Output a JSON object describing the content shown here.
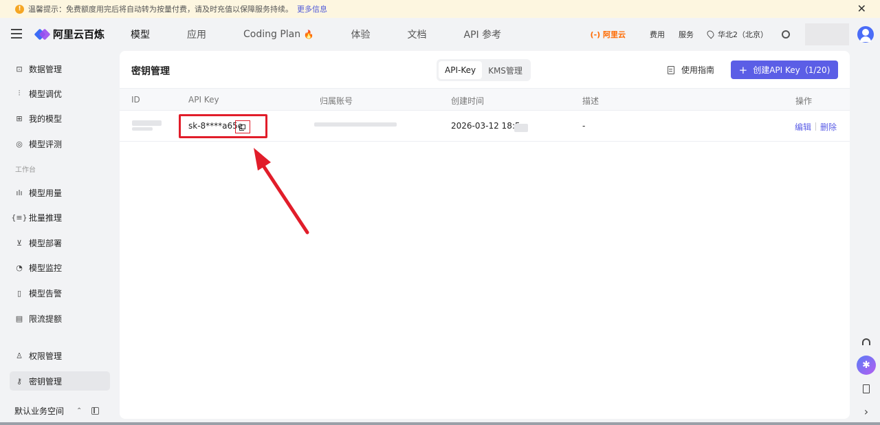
{
  "notice": {
    "text": "温馨提示：免费额度用完后将自动转为按量付费，请及时充值以保障服务持续。",
    "more_link": "更多信息",
    "warn_glyph": "!",
    "close_glyph": "✕"
  },
  "brand": {
    "name": "阿里云百炼"
  },
  "nav": {
    "tabs": [
      {
        "label": "模型"
      },
      {
        "label": "应用"
      },
      {
        "label": "Coding Plan"
      },
      {
        "label": "体验"
      },
      {
        "label": "文档"
      },
      {
        "label": "API 参考"
      }
    ],
    "flame": "🔥",
    "aliyun": "(-) 阿里云",
    "fee": "费用",
    "service": "服务",
    "region": "华北2（北京）"
  },
  "sidebar": {
    "items": [
      {
        "label": "数据管理",
        "icon": "chart-line-icon",
        "glyph": "⊡"
      },
      {
        "label": "模型调优",
        "icon": "sliders-icon",
        "glyph": "⫶"
      },
      {
        "label": "我的模型",
        "icon": "grid-icon",
        "glyph": "⊞"
      },
      {
        "label": "模型评测",
        "icon": "target-icon",
        "glyph": "◎"
      }
    ],
    "section_label": "工作台",
    "work_items": [
      {
        "label": "模型用量",
        "icon": "bar-chart-icon",
        "glyph": "ılı"
      },
      {
        "label": "批量推理",
        "icon": "brackets-icon",
        "glyph": "{≡}"
      },
      {
        "label": "模型部署",
        "icon": "deploy-icon",
        "glyph": "⊻"
      },
      {
        "label": "模型监控",
        "icon": "pie-chart-icon",
        "glyph": "◔"
      },
      {
        "label": "模型告警",
        "icon": "alert-icon",
        "glyph": "▯"
      },
      {
        "label": "限流提额",
        "icon": "database-icon",
        "glyph": "▤"
      }
    ],
    "bottom_items": [
      {
        "label": "权限管理",
        "icon": "user-icon",
        "glyph": "♙"
      },
      {
        "label": "密钥管理",
        "icon": "key-icon",
        "glyph": "⚷"
      }
    ],
    "workspace": "默认业务空间",
    "workspace_chevron": "⌃"
  },
  "page": {
    "title": "密钥管理",
    "tabs": [
      "API-Key",
      "KMS管理"
    ],
    "guide": "使用指南",
    "create_plus": "+",
    "create_button": "创建API Key（1/20)"
  },
  "table": {
    "headers": [
      "ID",
      "API Key",
      "归属账号",
      "创建时间",
      "描述",
      "操作"
    ],
    "rows": [
      {
        "api_key": "sk-8****a65e",
        "created": "2026-03-12 18:5",
        "description": "-",
        "edit": "编辑",
        "delete": "删除"
      }
    ]
  },
  "colors": {
    "accent": "#5b5ee6",
    "highlight": "#e11d2a",
    "notice_bg": "#fdf6e0",
    "aliyun_orange": "#ff6a00"
  },
  "right_tools": {
    "ai_glyph": "✱",
    "expand_glyph": "›"
  }
}
